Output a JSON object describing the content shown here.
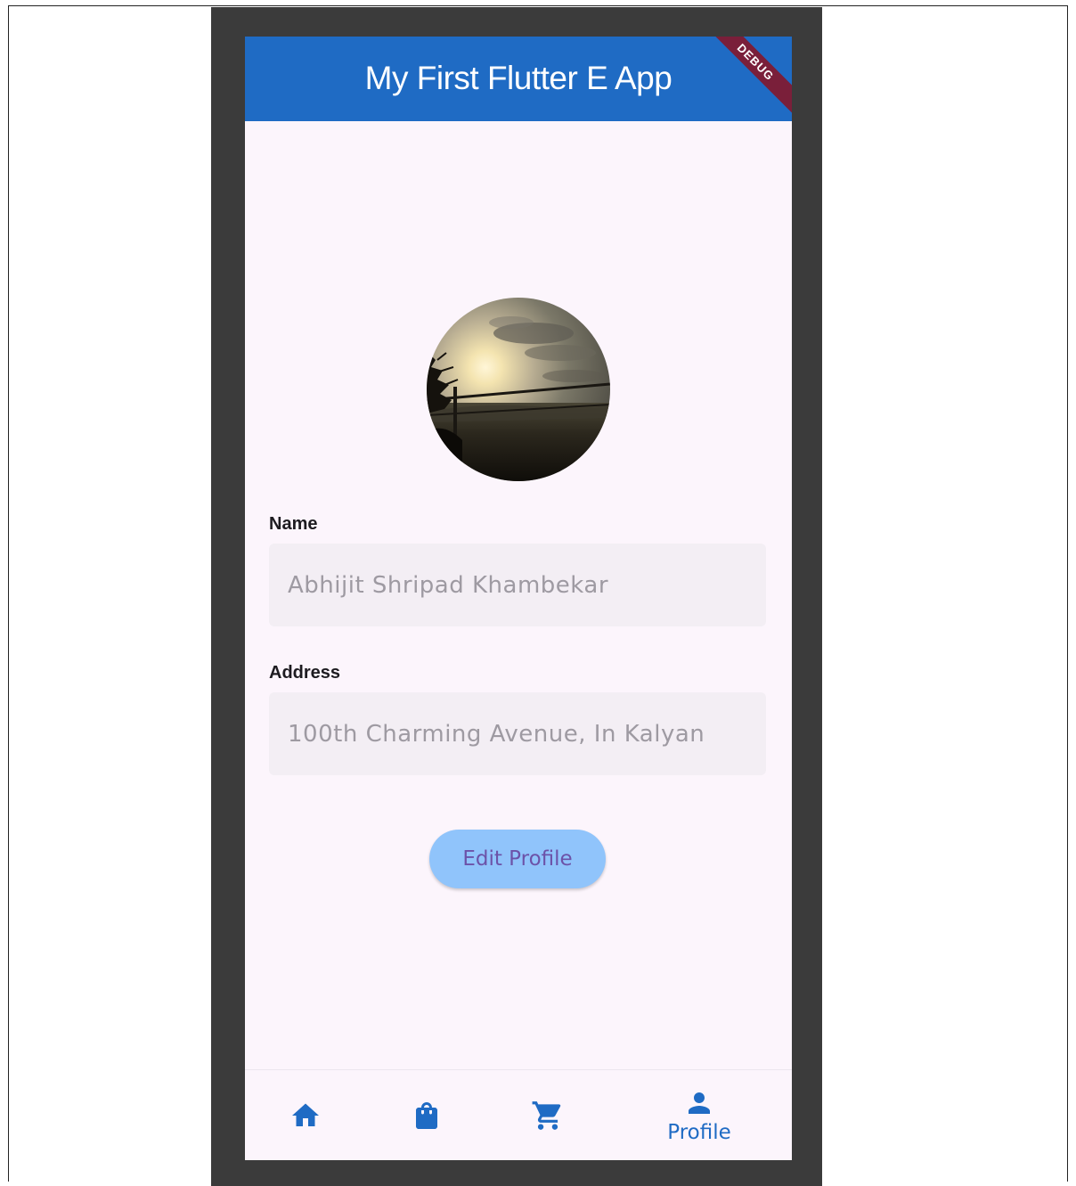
{
  "app_bar": {
    "title": "My First Flutter E App",
    "debug_banner": "DEBUG",
    "color": "#1f6bc4"
  },
  "profile": {
    "avatar_icon": "profile-photo-sunset",
    "name_label": "Name",
    "name_placeholder": "Abhijit Shripad Khambekar",
    "address_label": "Address",
    "address_placeholder": "100th Charming Avenue, In Kalyan",
    "edit_button_label": "Edit Profile"
  },
  "bottom_nav": {
    "items": [
      {
        "icon": "home-icon",
        "label": ""
      },
      {
        "icon": "shopping-bag-icon",
        "label": ""
      },
      {
        "icon": "cart-icon",
        "label": ""
      },
      {
        "icon": "person-icon",
        "label": "Profile"
      }
    ],
    "selected_index": 3,
    "accent_color": "#1f6bc4"
  }
}
